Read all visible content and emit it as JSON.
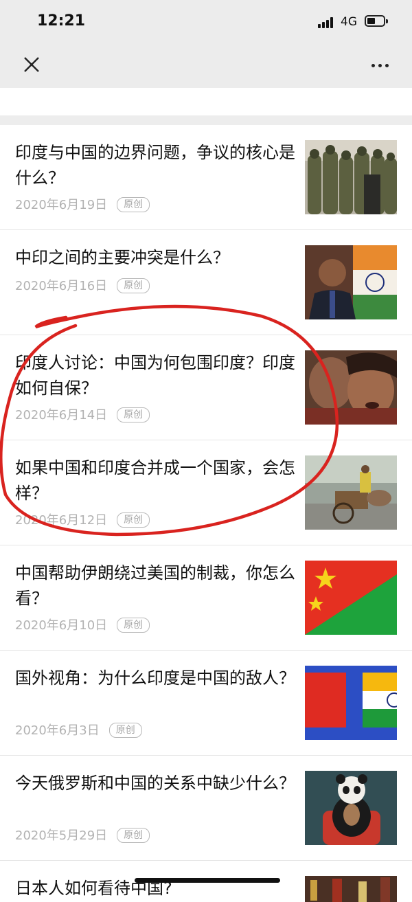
{
  "status_bar": {
    "time": "12:21",
    "network": "4G"
  },
  "nav": {
    "close_icon": "close-icon",
    "more_icon": "more-icon"
  },
  "articles": [
    {
      "title": "印度与中国的边界问题，争议的核心是什么？",
      "date": "2020年6月19日",
      "badge": "原创",
      "thumb": "soldiers-photo"
    },
    {
      "title": "中印之间的主要冲突是什么？",
      "date": "2020年6月16日",
      "badge": "原创",
      "thumb": "official-with-flag-photo"
    },
    {
      "title": "印度人讨论：中国为何包围印度？印度如何自保？",
      "date": "2020年6月14日",
      "badge": "原创",
      "thumb": "crying-women-photo"
    },
    {
      "title": "如果中国和印度合并成一个国家，会怎样？",
      "date": "2020年6月12日",
      "badge": "原创",
      "thumb": "street-cart-photo"
    },
    {
      "title": "中国帮助伊朗绕过美国的制裁，你怎么看？",
      "date": "2020年6月10日",
      "badge": "原创",
      "thumb": "china-iran-flags-image"
    },
    {
      "title": "国外视角：为什么印度是中国的敌人？",
      "date": "2020年6月3日",
      "badge": "原创",
      "thumb": "china-india-flags-image"
    },
    {
      "title": "今天俄罗斯和中国的关系中缺少什么？",
      "date": "2020年5月29日",
      "badge": "原创",
      "thumb": "panda-bear-image"
    },
    {
      "title": "日本人如何看待中国?",
      "date": "",
      "badge": "",
      "thumb": "city-street-photo"
    }
  ],
  "colors": {
    "annotation": "#d9231f",
    "meta": "#b2b2b2",
    "nav_bg": "#ececec"
  }
}
